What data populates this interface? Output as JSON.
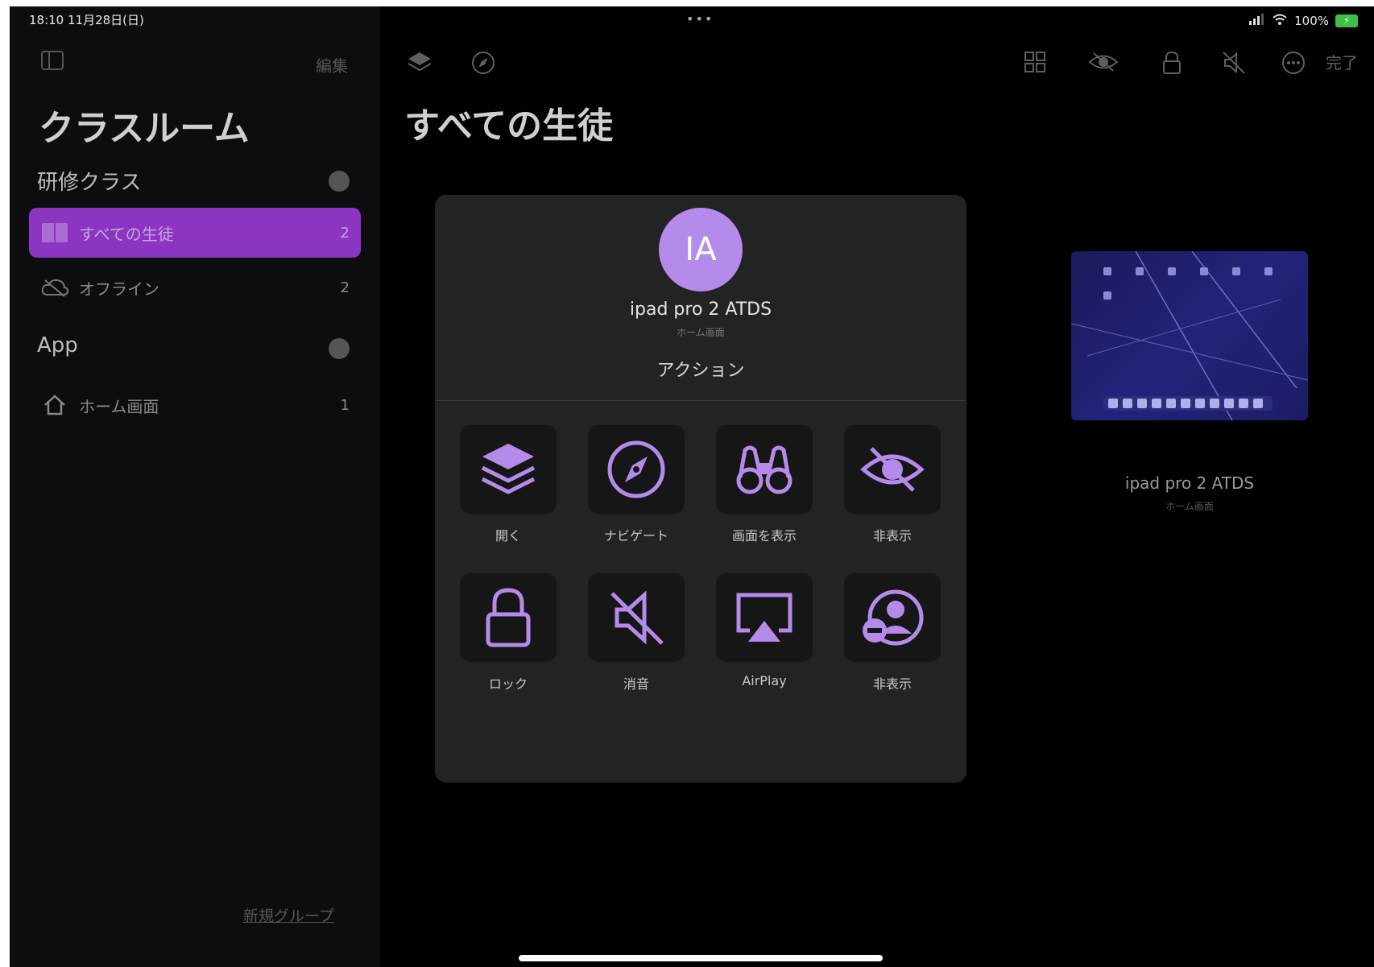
{
  "status": {
    "time_date": "18:10  11月28日(日)",
    "battery": "100%",
    "dots": "•••"
  },
  "sidebar": {
    "edit_label": "編集",
    "title": "クラスルーム",
    "section1": {
      "label": "研修クラス",
      "badge": "⊖"
    },
    "items": [
      {
        "label": "すべての生徒",
        "count": "2"
      },
      {
        "label": "オフライン",
        "count": "2"
      }
    ],
    "section2": {
      "label": "App",
      "badge": "⊖"
    },
    "apps": [
      {
        "label": "ホーム画面",
        "count": "1"
      }
    ],
    "footer": "新規グループ"
  },
  "main": {
    "title": "すべての生徒",
    "done_label": "完了"
  },
  "popover": {
    "avatar_initials": "IA",
    "device_name": "ipad pro 2 ATDS",
    "device_sub": "ホーム画面",
    "header": "アクション",
    "actions": [
      {
        "icon": "layers-icon",
        "label": "開く"
      },
      {
        "icon": "compass-icon",
        "label": "ナビゲート"
      },
      {
        "icon": "binoculars-icon",
        "label": "画面を表示"
      },
      {
        "icon": "eye-slash-icon",
        "label": "非表示"
      },
      {
        "icon": "lock-icon",
        "label": "ロック"
      },
      {
        "icon": "mute-icon",
        "label": "消音"
      },
      {
        "icon": "airplay-icon",
        "label": "AirPlay"
      },
      {
        "icon": "person-minus-icon",
        "label": "非表示"
      }
    ]
  },
  "device_card": {
    "name": "ipad pro 2 ATDS",
    "sub": "ホーム画面"
  },
  "colors": {
    "accent": "#b48bea",
    "selected": "#8b35c0"
  }
}
